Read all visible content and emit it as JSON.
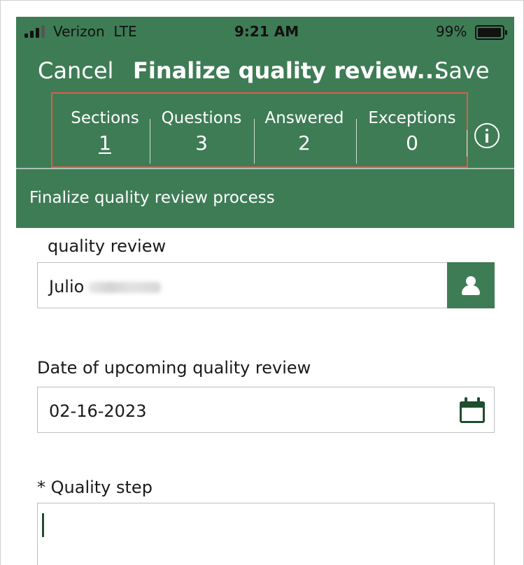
{
  "status_bar": {
    "carrier": "Verizon  LTE",
    "time": "9:21 AM",
    "battery": "99%"
  },
  "nav": {
    "cancel": "Cancel",
    "title": "Finalize quality review...",
    "save": "Save"
  },
  "stats": [
    {
      "label": "Sections",
      "value": "1"
    },
    {
      "label": "Questions",
      "value": "3"
    },
    {
      "label": "Answered",
      "value": "2"
    },
    {
      "label": "Exceptions",
      "value": "0"
    }
  ],
  "section": {
    "title": "Finalize quality review process"
  },
  "form": {
    "reviewer": {
      "label": "quality review",
      "value": "Julio"
    },
    "date": {
      "label": "Date of upcoming quality review",
      "value": "02-16-2023"
    },
    "step": {
      "label": "* Quality step",
      "value": ""
    }
  },
  "colors": {
    "header_green": "#3e7c55",
    "highlight_red": "#e05a4a",
    "icon_dark_green": "#1f4d2f"
  },
  "icons": [
    "signal-icon",
    "battery-icon",
    "info-icon",
    "person-icon",
    "calendar-icon"
  ]
}
